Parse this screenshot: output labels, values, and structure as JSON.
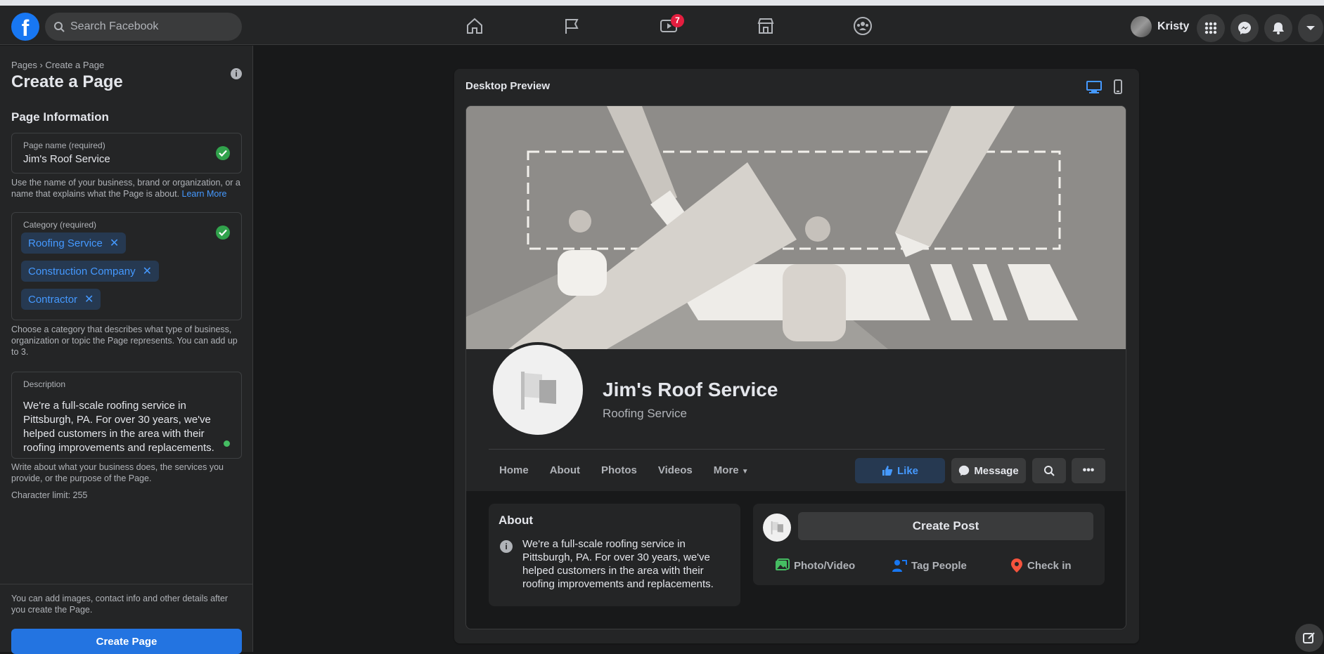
{
  "nav": {
    "search_placeholder": "Search Facebook",
    "watch_badge": "7",
    "user_name": "Kristy"
  },
  "sidebar": {
    "breadcrumb": "Pages › Create a Page",
    "title": "Create a Page",
    "section_title": "Page Information",
    "page_name": {
      "label": "Page name (required)",
      "value": "Jim's Roof Service",
      "help": "Use the name of your business, brand or organization, or a name that explains what the Page is about.",
      "learn_more": "Learn More"
    },
    "category": {
      "label": "Category (required)",
      "chips": [
        "Roofing Service",
        "Construction Company",
        "Contractor"
      ],
      "help": "Choose a category that describes what type of business, organization or topic the Page represents. You can add up to 3."
    },
    "description": {
      "label": "Description",
      "value": "We're a full-scale roofing service in Pittsburgh, PA. For over 30 years, we've helped customers in the area with their roofing improvements and replacements.",
      "help": "Write about what your business does, the services you provide, or the purpose of the Page.",
      "limit": "Character limit: 255"
    },
    "footer_note": "You can add images, contact info and other details after you create the Page.",
    "create_button": "Create Page"
  },
  "preview": {
    "title": "Desktop Preview",
    "page_name": "Jim's Roof Service",
    "page_category": "Roofing Service",
    "tabs": [
      "Home",
      "About",
      "Photos",
      "Videos",
      "More"
    ],
    "like_label": "Like",
    "message_label": "Message",
    "about_title": "About",
    "about_text": "We're a full-scale roofing service in Pittsburgh, PA. For over 30 years, we've helped customers in the area with their roofing improvements and replacements.",
    "create_post": "Create Post",
    "actions": [
      "Photo/Video",
      "Tag People",
      "Check in"
    ]
  },
  "colors": {
    "accent": "#2374e1",
    "link": "#4599ff",
    "success": "#31a24c",
    "badge": "#e41e3f"
  }
}
